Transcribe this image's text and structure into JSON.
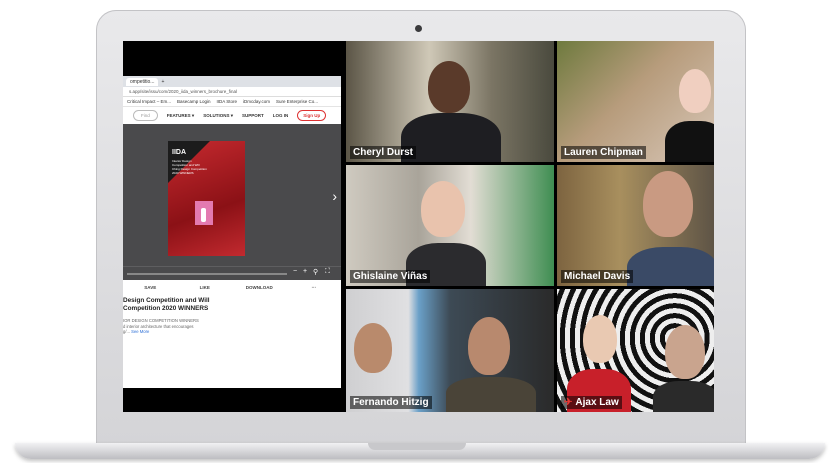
{
  "browser": {
    "tabs": [
      "ompetitio...",
      "+"
    ],
    "url": "s.app/site/issu/com/2020_iida_winners_brochure_final",
    "bookmarks": [
      "Critical Impact – Em...",
      "Basecamp Login",
      "IIDA Store",
      "iDmcday.com",
      "Sure Enterprise Co..."
    ],
    "site_nav": {
      "find": "Find",
      "features": "FEATURES ▾",
      "solutions": "SOLUTIONS ▾",
      "support": "SUPPORT",
      "login": "LOG IN",
      "signup": "Sign Up"
    },
    "cover": {
      "brand": "IIDA",
      "text": "Interior Design Competition and Will Ching Design Competition 2020 WINNERS"
    },
    "actions": [
      "SAVE",
      "LIKE",
      "DOWNLOAD",
      "⋯"
    ],
    "title_line1": "Design Competition and Will",
    "title_line2": "Competition 2020 WINNERS",
    "snippet_line1": "IOR DESIGN COMPETITION WINNERS",
    "snippet_line2": "d interior architecture that encourages",
    "snippet_line3": "g/... ",
    "see_more": "See More"
  },
  "participants": [
    {
      "name": "Cheryl Durst",
      "speaking": true
    },
    {
      "name": "Lauren Chipman",
      "speaking": false
    },
    {
      "name": "Ghislaine Viñas",
      "speaking": false
    },
    {
      "name": "Michael Davis",
      "speaking": false
    },
    {
      "name": "Fernando Hitzig",
      "speaking": false
    },
    {
      "name": "Ajax Law",
      "speaking": false
    }
  ],
  "colors": {
    "speaker_highlight": "#b9e63c",
    "record_red": "#e53935",
    "accent_red": "#c62a2f"
  }
}
